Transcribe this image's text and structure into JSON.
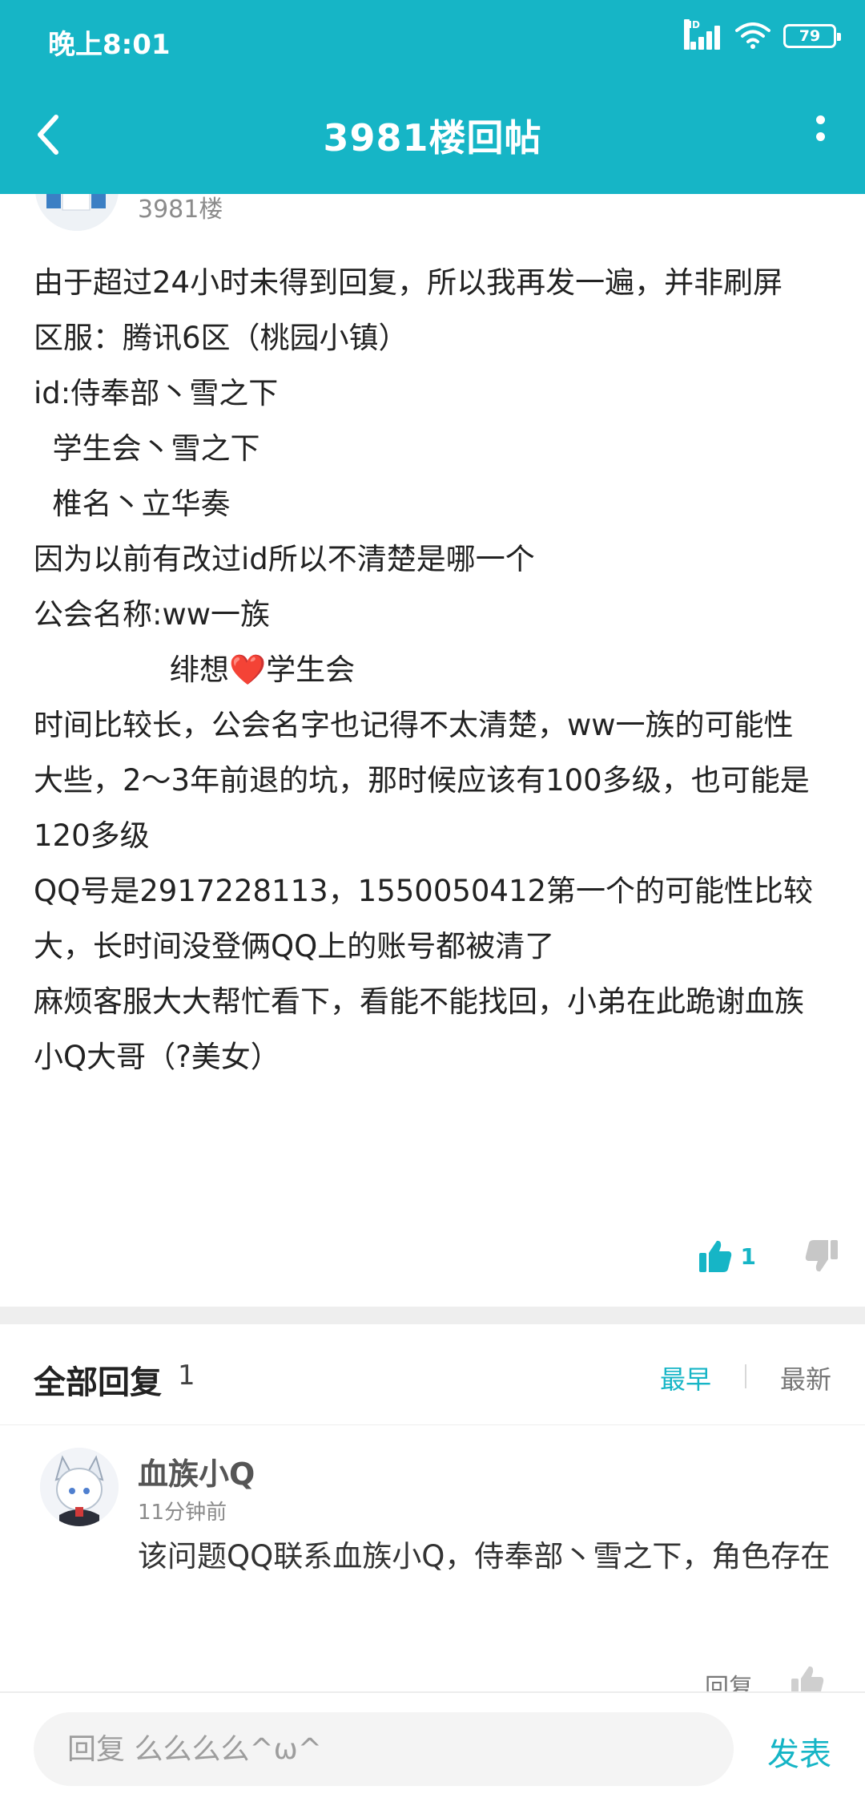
{
  "status_bar": {
    "time": "晚上8:01",
    "network": "HD",
    "battery": "79"
  },
  "header": {
    "title": "3981楼回帖"
  },
  "post": {
    "floor": "3981楼",
    "lines": [
      "由于超过24小时未得到回复，所以我再发一遍，并非刷屏",
      "区服：腾讯6区（桃园小镇）",
      "id:侍奉部丶雪之下",
      "  学生会丶雪之下",
      "  椎名丶立华奏",
      "因为以前有改过id所以不清楚是哪一个",
      "公会名称:ww一族"
    ],
    "guild_alt_prefix": "绯想",
    "guild_alt_emoji": "❤️",
    "guild_alt_suffix": "学生会",
    "lines_after": [
      "时间比较长，公会名字也记得不太清楚，ww一族的可能性",
      "大些，2～3年前退的坑，那时候应该有100多级，也可能是",
      "120多级",
      "QQ号是2917228113，1550050412第一个的可能性比较",
      "大，长时间没登俩QQ上的账号都被清了",
      "麻烦客服大大帮忙看下，看能不能找回，小弟在此跪谢血族",
      "小Q大哥（?美女）"
    ],
    "like_count": "1"
  },
  "replies": {
    "title": "全部回复",
    "count": "1",
    "sort_early": "最早",
    "sort_new": "最新",
    "items": [
      {
        "name": "血族小Q",
        "time": "11分钟前",
        "text": "该问题QQ联系血族小Q，侍奉部丶雪之下，角色存在",
        "reply_label": "回复"
      }
    ]
  },
  "bottom": {
    "placeholder": "回复 么么么么^ω^",
    "send_label": "发表"
  },
  "colors": {
    "accent": "#16b5c6",
    "heart": "#e0262f"
  }
}
